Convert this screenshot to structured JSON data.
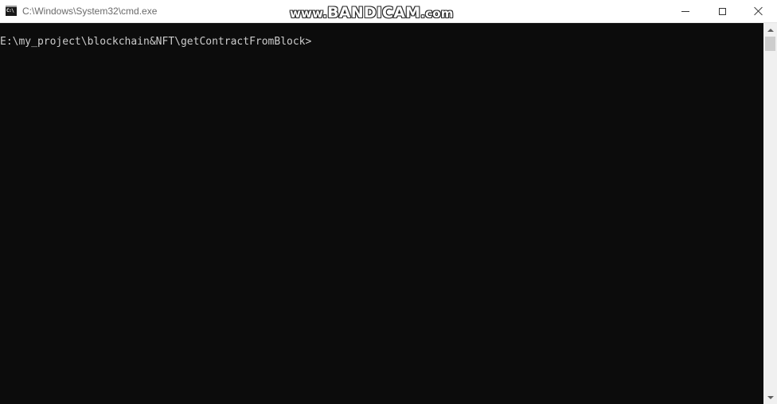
{
  "window": {
    "title": "C:\\Windows\\System32\\cmd.exe",
    "app_icon_text": "C:\\",
    "watermark": {
      "prefix": "www.",
      "main": "BANDICAM",
      "suffix": ".com"
    }
  },
  "console": {
    "prompt": "E:\\my_project\\blockchain&NFT\\getContractFromBlock>",
    "text_color": "#cccccc",
    "background_color": "#0c0c0c"
  },
  "icons": {
    "minimize": "minimize-icon",
    "maximize": "maximize-icon",
    "close": "close-icon"
  }
}
